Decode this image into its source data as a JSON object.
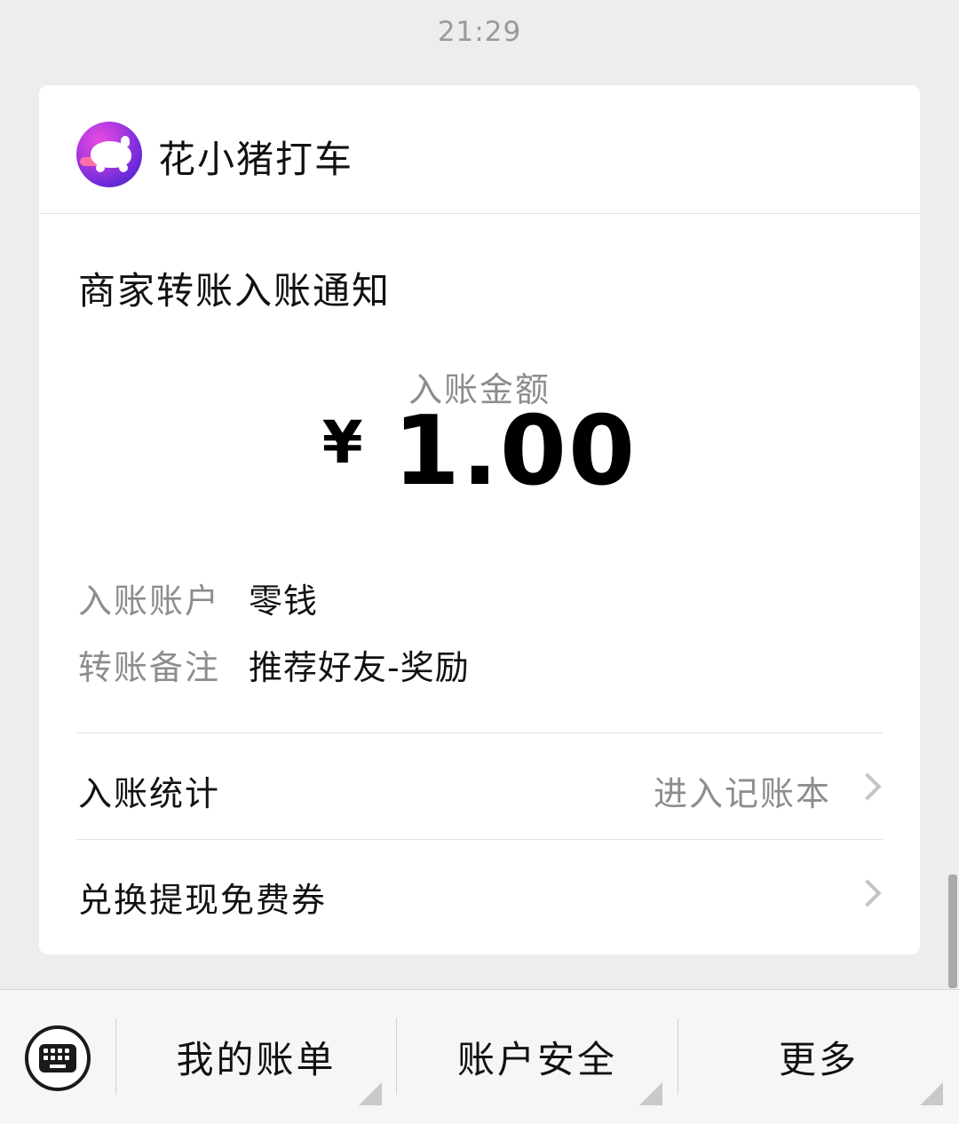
{
  "timestamp": "21:29",
  "card": {
    "app_name": "花小猪打车",
    "title": "商家转账入账通知",
    "amount_label": "入账金额",
    "currency": "¥",
    "amount": "1.00",
    "details": [
      {
        "key": "入账账户",
        "value": "零钱"
      },
      {
        "key": "转账备注",
        "value": "推荐好友-奖励"
      }
    ],
    "stats_label": "入账统计",
    "stats_link": "进入记账本",
    "coupon_label": "兑换提现免费券"
  },
  "bottom_menu": {
    "items": [
      {
        "label": "我的账单"
      },
      {
        "label": "账户安全"
      },
      {
        "label": "更多"
      }
    ]
  },
  "icons": {
    "keyboard": "keyboard-icon",
    "chevron": "chevron-right-icon",
    "logo": "app-logo-icon"
  }
}
